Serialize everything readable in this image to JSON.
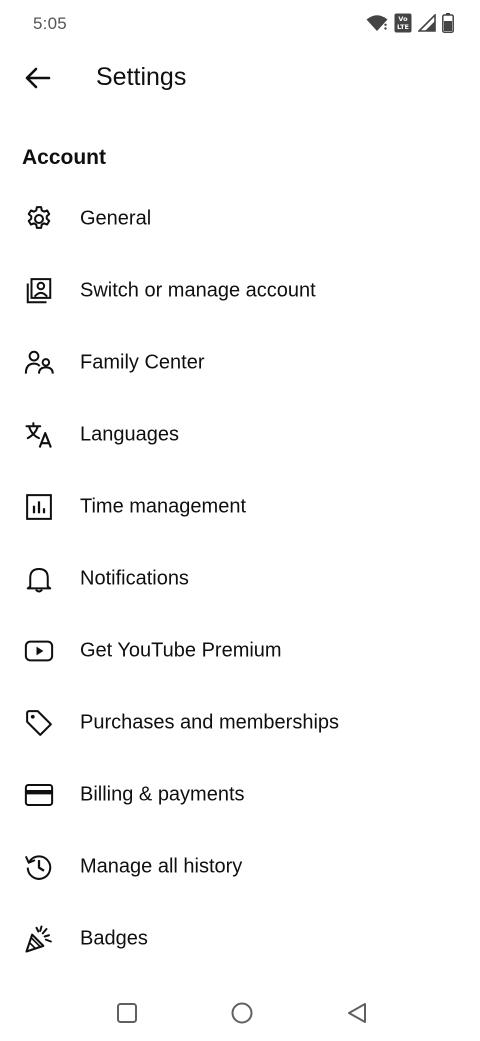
{
  "status_bar": {
    "time": "5:05",
    "icons": [
      "wifi-icon",
      "volte-icon",
      "signal-icon",
      "battery-icon"
    ],
    "volte_text": "Vo LTE"
  },
  "app_bar": {
    "back_icon": "arrow-left-icon",
    "title": "Settings"
  },
  "section": {
    "heading": "Account"
  },
  "menu": {
    "items": [
      {
        "label": "General",
        "icon": "gear-icon"
      },
      {
        "label": "Switch or manage account",
        "icon": "account-switch-icon"
      },
      {
        "label": "Family Center",
        "icon": "family-icon"
      },
      {
        "label": "Languages",
        "icon": "translate-icon"
      },
      {
        "label": "Time management",
        "icon": "bar-chart-icon"
      },
      {
        "label": "Notifications",
        "icon": "bell-icon"
      },
      {
        "label": "Get YouTube Premium",
        "icon": "play-button-icon"
      },
      {
        "label": "Purchases and memberships",
        "icon": "tag-icon"
      },
      {
        "label": "Billing & payments",
        "icon": "credit-card-icon"
      },
      {
        "label": "Manage all history",
        "icon": "history-icon"
      },
      {
        "label": "Badges",
        "icon": "party-popper-icon"
      }
    ]
  },
  "nav_bar": {
    "icons": [
      "recents-square-icon",
      "home-circle-icon",
      "back-triangle-icon"
    ]
  },
  "colors": {
    "text": "#0f0f0f",
    "status_text": "#555555",
    "background": "#ffffff",
    "nav_icon": "#606060"
  }
}
